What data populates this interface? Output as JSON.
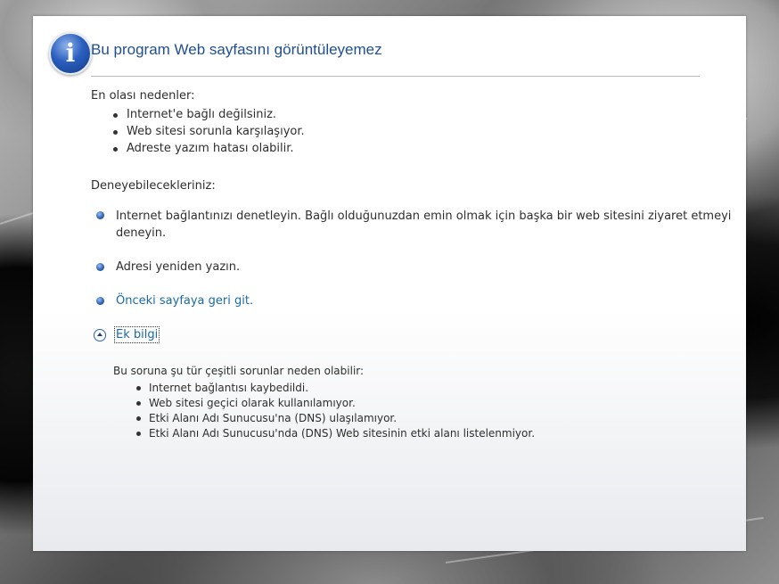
{
  "window": {
    "title": "Bu program Web sayfasını görüntüleyemez"
  },
  "causes": {
    "heading": "En olası nedenler:",
    "items": [
      "Internet'e bağlı değilsiniz.",
      "Web sitesi sorunla karşılaşıyor.",
      "Adreste yazım hatası olabilir."
    ]
  },
  "tryit": {
    "heading": "Deneyebilecekleriniz:",
    "items": [
      {
        "line1": "Internet bağlantınızı denetleyin. Bağlı olduğunuzdan emin olmak için başka bir web sitesini ziyaret etmeyi",
        "line2": "deneyin."
      },
      {
        "text": "Adresi yeniden yazın."
      },
      {
        "text": "Önceki sayfaya geri git."
      }
    ],
    "more_info_label": "Ek bilgi"
  },
  "more_info": {
    "heading": "Bu soruna şu tür çeşitli sorunlar neden olabilir:",
    "items": [
      "Internet bağlantısı kaybedildi.",
      "Web sitesi geçici olarak kullanılamıyor.",
      "Etki Alanı Adı Sunucusu'na (DNS) ulaşılamıyor.",
      "Etki Alanı Adı Sunucusu'nda (DNS) Web sitesinin etki alanı listelenmiyor."
    ]
  },
  "icons": {
    "info": "info-icon",
    "bullet": "blue-bullet-icon",
    "toggle": "collapse-arrow-icon"
  },
  "colors": {
    "title": "#1f4f91",
    "link": "#1a6aa8"
  }
}
